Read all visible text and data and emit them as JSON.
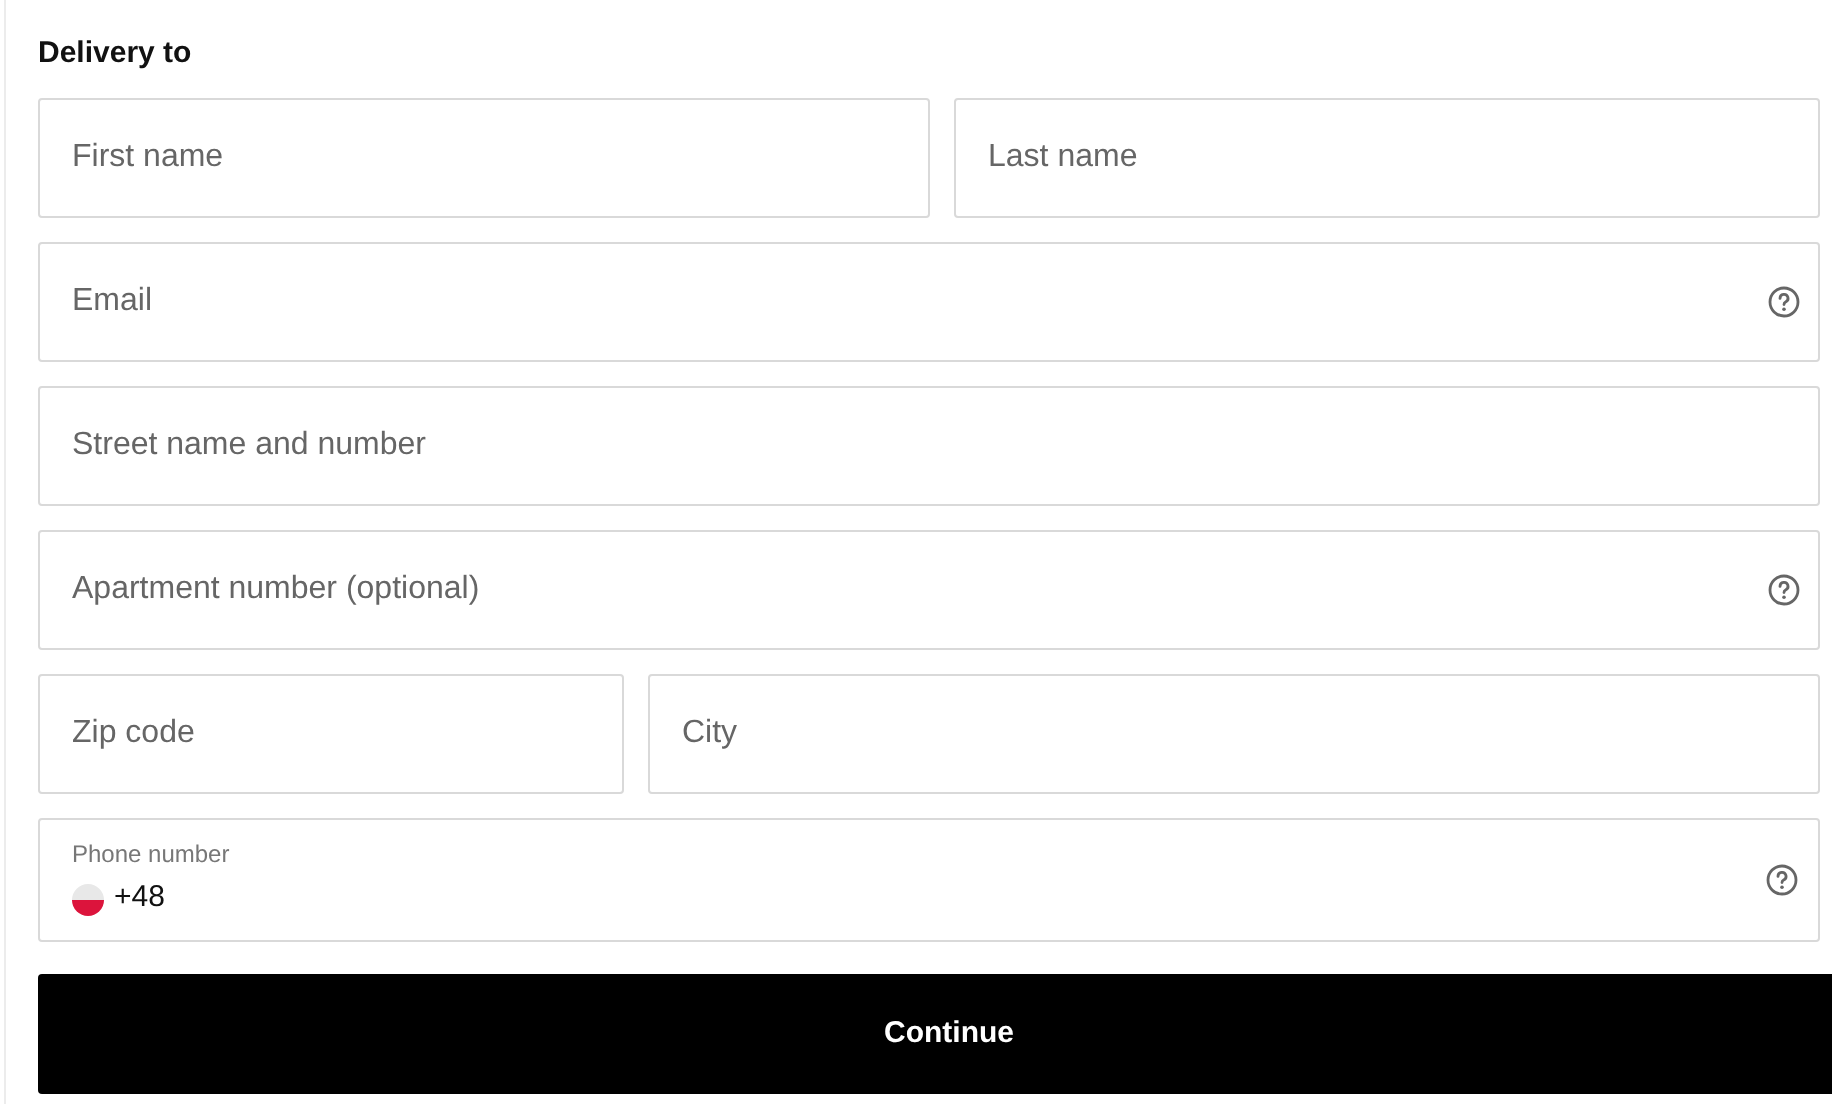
{
  "title": "Delivery to",
  "rows": [
    [
      {
        "kind": "text",
        "placeholder": "First name",
        "help": false
      },
      {
        "kind": "text",
        "placeholder": "Last name",
        "help": false
      }
    ],
    [
      {
        "kind": "text",
        "placeholder": "Email",
        "help": true
      }
    ],
    [
      {
        "kind": "text",
        "placeholder": "Street name and number",
        "help": false
      }
    ],
    [
      {
        "kind": "text",
        "placeholder": "Apartment number (optional)",
        "help": true
      }
    ],
    [
      {
        "kind": "text",
        "placeholder": "Zip code",
        "help": false
      },
      {
        "kind": "text",
        "placeholder": "City",
        "help": false
      }
    ],
    [
      {
        "kind": "phone",
        "label": "Phone number",
        "value": "+48",
        "help": true
      }
    ]
  ],
  "button": "Continue"
}
